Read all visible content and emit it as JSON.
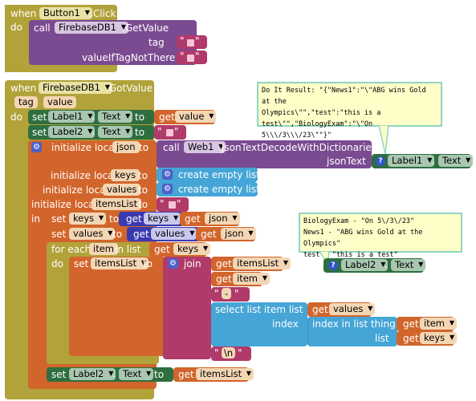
{
  "event1": {
    "when": "when",
    "component": "Button1",
    "event": ".Click",
    "do": "do",
    "call": "call",
    "db": "FirebaseDB1",
    "method": ".GetValue",
    "tag": "tag",
    "vitn": "valueIfTagNotThere",
    "q1": "\" ",
    "q2": " \""
  },
  "event2": {
    "when": "when",
    "component": "FirebaseDB1",
    "event": ".GotValue",
    "p1": "tag",
    "p2": "value",
    "do": "do"
  },
  "s1": {
    "set": "set",
    "comp": "Label1",
    "prop": "Text",
    "to": "to",
    "get": "get",
    "var": "value"
  },
  "s2": {
    "set": "set",
    "comp": "Label2",
    "prop": "Text",
    "to": "to"
  },
  "json_local": {
    "init": "initialize local",
    "name": "json",
    "to": "to",
    "call": "call",
    "web": "Web1",
    "method": ".JsonTextDecodeWithDictionaries",
    "param": "jsonText",
    "label": "Label1",
    "prop": "Text"
  },
  "keys_local": {
    "init": "initialize local",
    "name": "keys",
    "to": "to",
    "op": "create empty list"
  },
  "values_local": {
    "init": "initialize local",
    "name": "values",
    "to": "to",
    "op": "create empty list"
  },
  "itemslist_local": {
    "init": "initialize local",
    "name": "itemsList",
    "to": "to"
  },
  "in": "in",
  "set_keys": {
    "set": "set",
    "var": "keys",
    "to": "to",
    "get": "get",
    "gvar": "keys",
    "get2": "get",
    "gvar2": "json"
  },
  "set_values": {
    "set": "set",
    "var": "values",
    "to": "to",
    "get": "get",
    "gvar": "values",
    "get2": "get",
    "gvar2": "json"
  },
  "foreach": {
    "label": "for each",
    "item": "item",
    "in_list": "in list",
    "get": "get",
    "list": "keys",
    "do": "do"
  },
  "set_items": {
    "set": "set",
    "var": "itemsList",
    "to": "to",
    "join": "join",
    "g1": "itemsList",
    "g2": "item",
    "sep": "-",
    "newline": "\\n",
    "get": "get"
  },
  "select": {
    "label": "select list item  list",
    "get": "get",
    "values": "values",
    "index": "index",
    "indexin": "index in list  thing",
    "item": "item",
    "list": "list",
    "keys": "keys"
  },
  "final_set": {
    "set": "set",
    "comp": "Label2",
    "prop": "Text",
    "to": "to",
    "get": "get",
    "var": "itemsList"
  },
  "comment1": {
    "lines": [
      "Do It Result: \"{\"News1\":\"\\\"ABG wins Gold at the",
      "Olympics\\\"\",\"test\":\"this is a",
      "test\\\"\",\"BiologyExam\":\"\\\"On 5\\\\\\/3\\\\\\/23\\\"\"}\""
    ]
  },
  "comment2": {
    "lines": [
      "BiologyExam - \"On 5\\/3\\/23\"",
      "News1 - \"ABG wins Gold at the Olympics\"",
      "test - \"this is a test\""
    ]
  },
  "label1_block": {
    "comp": "Label1",
    "prop": "Text"
  },
  "label2_block": {
    "comp": "Label2",
    "prop": "Text"
  },
  "colors": {
    "control": "#b1a23a",
    "procedure": "#7a4b91",
    "variable": "#d2652b",
    "text": "#b03a6a",
    "component": "#2e6e3f",
    "list": "#45a5d6",
    "string_pink": "#b03a6a"
  }
}
